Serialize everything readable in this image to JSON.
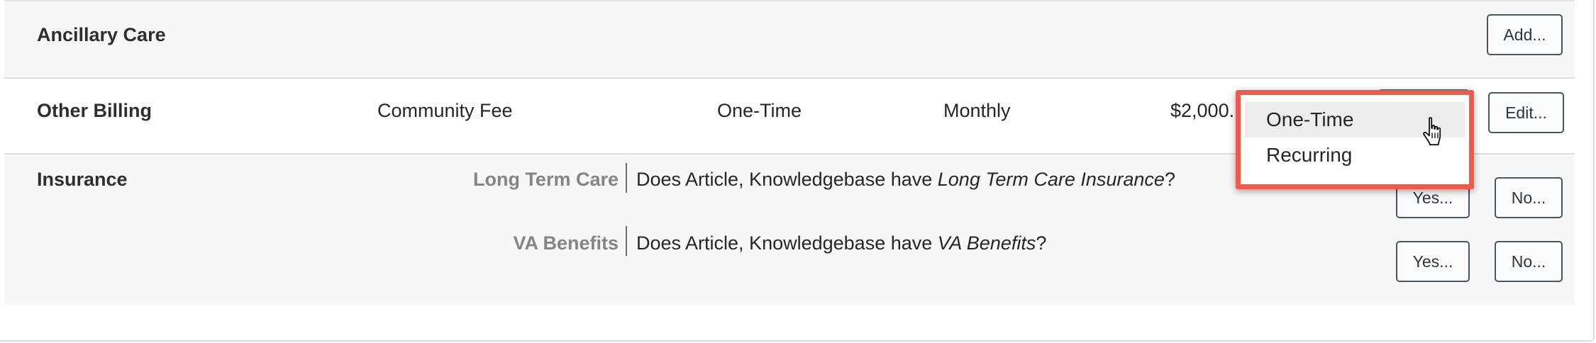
{
  "sections": {
    "ancillary": {
      "title": "Ancillary Care",
      "add_label": "Add..."
    },
    "other_billing": {
      "title": "Other Billing",
      "item": "Community Fee",
      "frequency": "One-Time",
      "cycle": "Monthly",
      "amount": "$2,000.",
      "edit_label": "Edit..."
    },
    "insurance": {
      "title": "Insurance",
      "rows": [
        {
          "label": "Long Term Care",
          "question_prefix": "Does Article, Knowledgebase have ",
          "question_emphasis": "Long Term Care Insurance",
          "question_suffix": "?",
          "yes_label": "Yes...",
          "no_label": "No..."
        },
        {
          "label": "VA Benefits",
          "question_prefix": "Does Article, Knowledgebase have ",
          "question_emphasis": "VA Benefits",
          "question_suffix": "?",
          "yes_label": "Yes...",
          "no_label": "No..."
        }
      ]
    }
  },
  "dropdown": {
    "options": [
      "One-Time",
      "Recurring"
    ],
    "highlighted": "One-Time",
    "highlight_color": "#ee5a4c"
  },
  "icons": {
    "cursor": "hand-pointer-icon"
  }
}
